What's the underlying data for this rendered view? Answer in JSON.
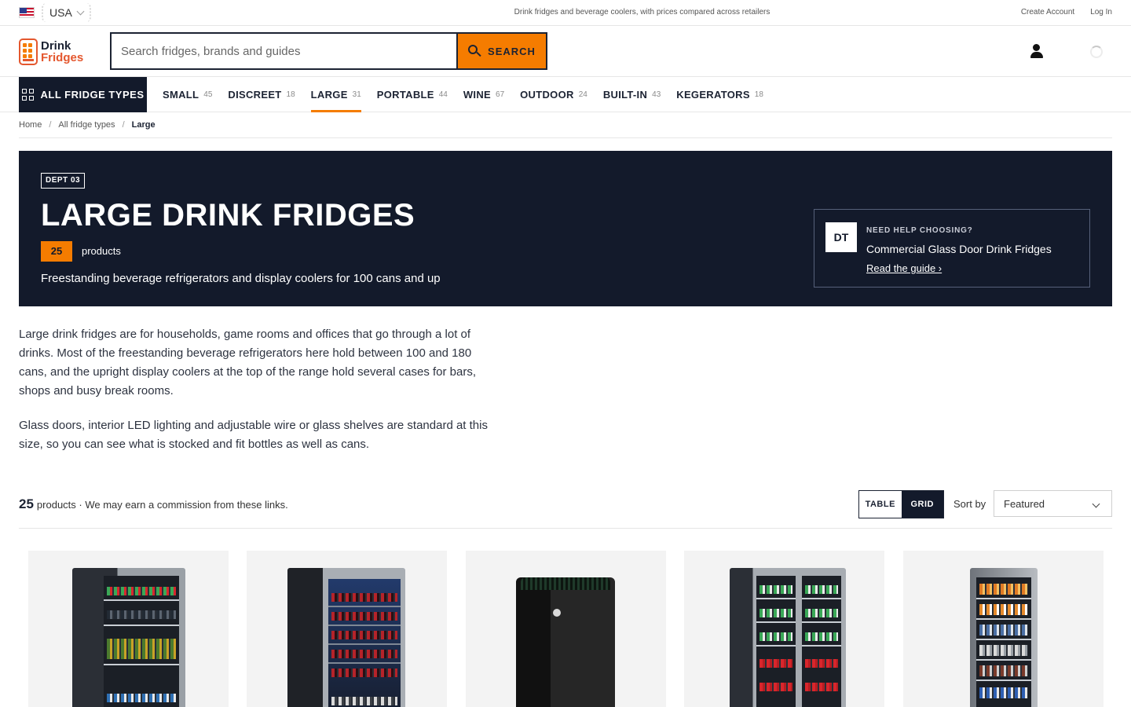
{
  "topbar": {
    "country": "USA",
    "tagline": "Drink fridges and beverage coolers, with prices compared across retailers",
    "links": [
      "Create Account",
      "Log In"
    ]
  },
  "header": {
    "logo_line1": "Drink",
    "logo_line2": "Fridges",
    "search_placeholder": "Search fridges, brands and guides",
    "search_button": "SEARCH"
  },
  "catnav": {
    "all_label": "ALL FRIDGE TYPES",
    "tabs": [
      {
        "name": "SMALL",
        "count": "45"
      },
      {
        "name": "DISCREET",
        "count": "18"
      },
      {
        "name": "LARGE",
        "count": "31",
        "active": true
      },
      {
        "name": "PORTABLE",
        "count": "44"
      },
      {
        "name": "WINE",
        "count": "67"
      },
      {
        "name": "OUTDOOR",
        "count": "24"
      },
      {
        "name": "BUILT-IN",
        "count": "43"
      },
      {
        "name": "KEGERATORS",
        "count": "18"
      }
    ]
  },
  "breadcrumb": [
    "Home",
    "All fridge types",
    "Large"
  ],
  "hero": {
    "dept": "DEPT 03",
    "title": "LARGE DRINK FRIDGES",
    "count": "25",
    "count_label": "products",
    "subtitle": "Freestanding beverage refrigerators and display coolers for 100 cans and up",
    "guide": {
      "avatar": "DT",
      "kicker": "NEED HELP CHOOSING?",
      "title": "Commercial Glass Door Drink Fridges",
      "link": "Read the guide ›"
    }
  },
  "intro": [
    "Large drink fridges are for households, game rooms and offices that go through a lot of drinks. Most of the freestanding beverage refrigerators here hold between 100 and 180 cans, and the upright display coolers at the top of the range hold several cases for bars, shops and busy break rooms.",
    "Glass doors, interior LED lighting and adjustable wire or glass shelves are standard at this size, so you can see what is stocked and fit bottles as well as cans."
  ],
  "results": {
    "count": "25",
    "note": "products · We may earn a commission from these links.",
    "view_table": "TABLE",
    "view_grid": "GRID",
    "active_view": "grid",
    "sort_label": "Sort by",
    "sort_value": "Featured"
  },
  "products": [
    {
      "image": "glass-door-beverage-fridge-image"
    },
    {
      "image": "wine-cooler-glass-door-image"
    },
    {
      "image": "black-mini-fridge-image"
    },
    {
      "image": "french-door-beverage-fridge-image"
    },
    {
      "image": "tall-display-beverage-fridge-image"
    }
  ],
  "colors": {
    "navy": "#131a2b",
    "accent": "#f57c00",
    "logo_red": "#e4572e"
  }
}
